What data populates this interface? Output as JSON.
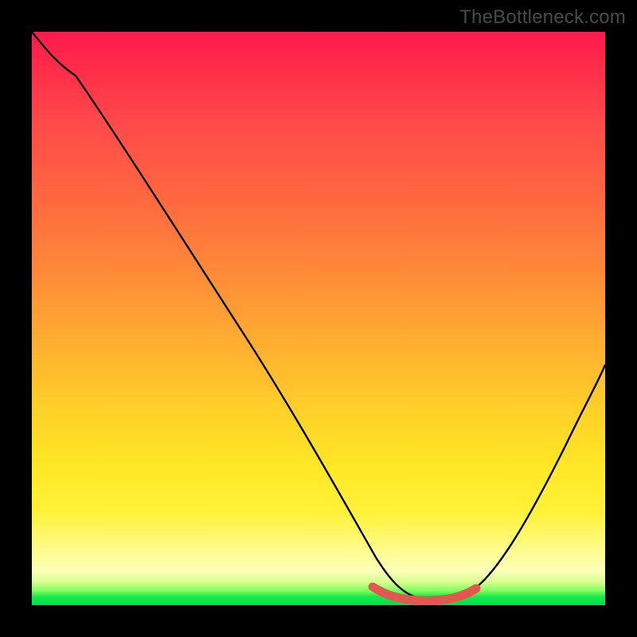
{
  "watermark": "TheBottleneck.com",
  "chart_data": {
    "type": "line",
    "title": "",
    "xlabel": "",
    "ylabel": "",
    "xlim": [
      0,
      100
    ],
    "ylim": [
      0,
      100
    ],
    "grid": false,
    "legend": false,
    "series": [
      {
        "name": "black-curve",
        "stroke": "#000000",
        "x": [
          0,
          3,
          8,
          15,
          22,
          30,
          38,
          46,
          54,
          59,
          62,
          66,
          72,
          76,
          80,
          86,
          92,
          100
        ],
        "values": [
          100,
          97,
          93,
          83,
          72,
          60,
          48,
          36,
          22,
          12,
          4,
          1,
          1,
          2,
          6,
          15,
          26,
          42
        ]
      },
      {
        "name": "red-flat-segment",
        "stroke": "#e0584e",
        "x": [
          59,
          62,
          64,
          67,
          70,
          73,
          75,
          77
        ],
        "values": [
          3,
          1.2,
          0.8,
          0.6,
          0.6,
          0.8,
          1.3,
          2.2
        ]
      }
    ],
    "colors": {
      "gradient_top": "#ff1a4d",
      "gradient_mid": "#ffd029",
      "gradient_bottom": "#00e04a",
      "curve": "#000000",
      "highlight": "#e0584e",
      "frame": "#000000"
    }
  }
}
